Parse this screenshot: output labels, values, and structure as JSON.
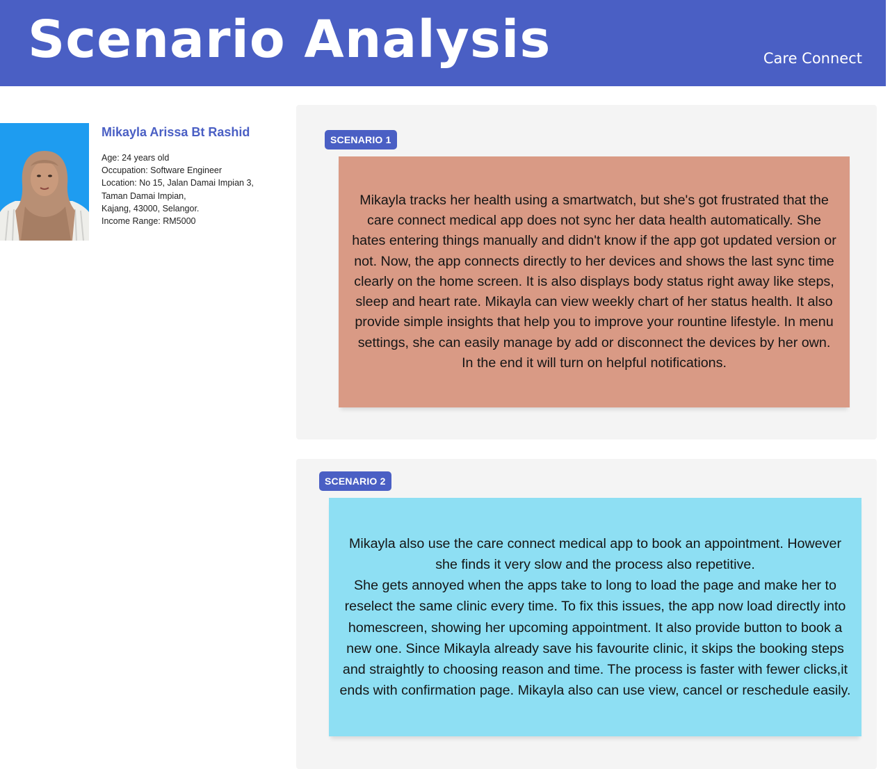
{
  "header": {
    "title": "Scenario Analysis",
    "brand": "Care Connect",
    "background_color": "#4a5fc4"
  },
  "persona": {
    "photo_icon": "person-photo",
    "name": "Mikayla Arissa Bt Rashid",
    "details": [
      "Age: 24 years old",
      "Occupation: Software Engineer",
      "Location: No 15, Jalan Damai Impian 3,",
      "Taman Damai Impian,",
      "Kajang, 43000, Selangor.",
      "Income Range: RM5000"
    ]
  },
  "scenarios": [
    {
      "badge": "SCENARIO 1",
      "color": "#d99a85",
      "text": "Mikayla tracks her health using a smartwatch, but she's got frustrated that the care connect medical app does not sync her data health automatically. She hates entering things manually and didn't know if the app got updated version or not. Now, the app connects directly to her devices and shows the last sync time clearly on the home screen. It is also displays body status right away like steps, sleep and heart rate. Mikayla can view weekly chart of her status health. It also provide simple insights that help you to improve your rountine lifestyle. In menu settings, she can easily manage by add or disconnect the devices by her own. In the end it will turn on helpful notifications."
    },
    {
      "badge": "SCENARIO 2",
      "color": "#8edff3",
      "paragraphs": [
        "Mikayla also use the care connect medical app to book an appointment. However she finds it very slow and the process also repetitive.",
        "She gets annoyed when the apps take to long to load the page and make her to reselect the same clinic every time. To fix this issues, the app now load directly into homescreen, showing her upcoming appointment. It also provide button to book a new one. Since Mikayla already save his favourite clinic, it skips the booking steps and straightly to choosing reason and time. The process is faster with fewer clicks,it ends with confirmation page. Mikayla also can use view, cancel or reschedule easily."
      ]
    }
  ]
}
